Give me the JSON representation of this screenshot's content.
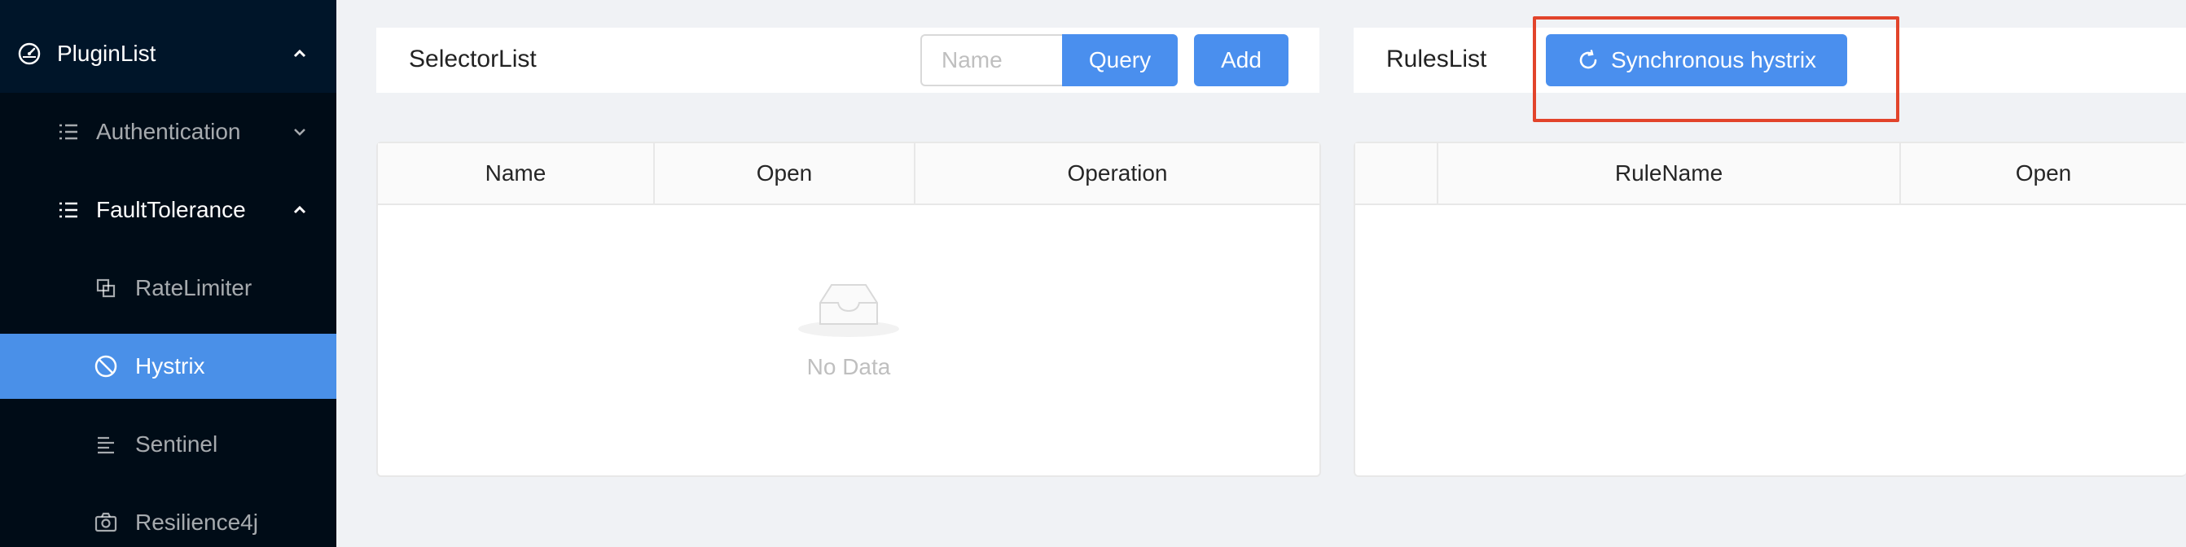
{
  "sidebar": {
    "root": {
      "label": "PluginList",
      "icon": "dashboard-icon",
      "arrow": "chevron-up-icon"
    },
    "groups": [
      {
        "label": "Authentication",
        "icon": "list-icon",
        "arrow": "chevron-down-icon"
      },
      {
        "label": "FaultTolerance",
        "icon": "list-icon",
        "arrow": "chevron-up-icon"
      }
    ],
    "items": [
      {
        "label": "RateLimiter",
        "icon": "block-icon"
      },
      {
        "label": "Hystrix",
        "icon": "stop-icon",
        "active": true
      },
      {
        "label": "Sentinel",
        "icon": "align-left-icon"
      },
      {
        "label": "Resilience4j",
        "icon": "camera-icon"
      }
    ]
  },
  "selector_panel": {
    "title": "SelectorList",
    "search_placeholder": "Name",
    "search_value": "",
    "query_label": "Query",
    "add_label": "Add",
    "columns": [
      "Name",
      "Open",
      "Operation"
    ],
    "empty_text": "No Data"
  },
  "rules_panel": {
    "title": "RulesList",
    "sync_label": "Synchronous hystrix",
    "sync_icon": "reload-icon",
    "columns": [
      "",
      "RuleName",
      "Open"
    ]
  },
  "colors": {
    "sidebar_bg": "#001529",
    "sidebar_sub_bg": "#000c17",
    "active_item": "#4a90e8",
    "primary": "#4a8fee",
    "highlight": "#e2442b",
    "page_bg": "#f0f2f5"
  }
}
